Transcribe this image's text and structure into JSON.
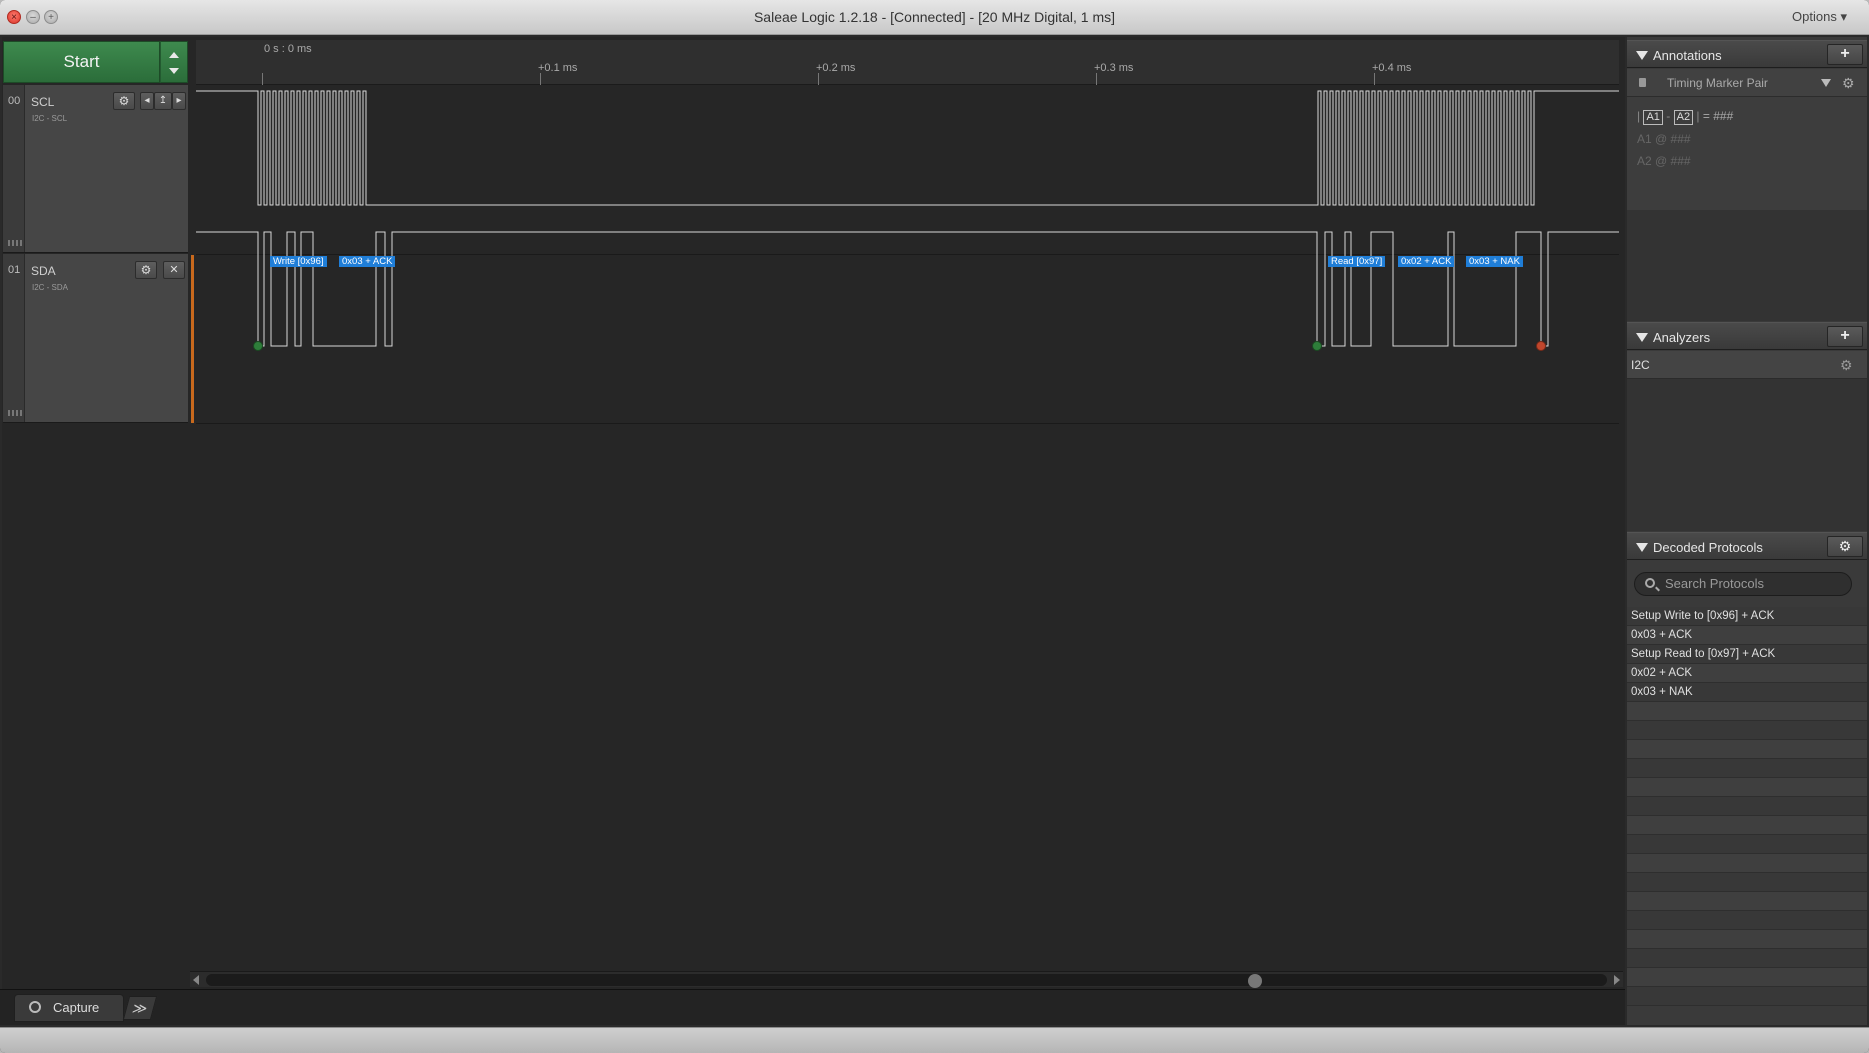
{
  "window": {
    "title": "Saleae Logic 1.2.18 - [Connected] - [20 MHz Digital, 1 ms]",
    "options_label": "Options ▾",
    "close_glyph": "×",
    "min_glyph": "–",
    "max_glyph": "+"
  },
  "capture": {
    "start_label": "Start"
  },
  "channels": [
    {
      "num": "00",
      "name": "SCL",
      "sub": "I2C - SCL"
    },
    {
      "num": "01",
      "name": "SDA",
      "sub": "I2C - SDA"
    }
  ],
  "channel_buttons": {
    "gear": "⚙",
    "prev": "◂",
    "trigger": "↥",
    "next": "▸",
    "close": "✕"
  },
  "timeline": {
    "reference": "0 s : 0 ms",
    "ticks": [
      "+0.1 ms",
      "+0.2 ms",
      "+0.3 ms",
      "+0.4 ms"
    ]
  },
  "decode_labels": [
    "Write [0x96]",
    "0x03 + ACK",
    "Read [0x97]",
    "0x02 + ACK",
    "0x03 + NAK"
  ],
  "annotations": {
    "title": "Annotations",
    "add": "+",
    "marker_pair": "Timing Marker Pair",
    "gear": "⚙",
    "line1": {
      "a": "A1",
      "sep": "-",
      "b": "A2",
      "eq": "= ###"
    },
    "line2": "A1  @  ###",
    "line3": "A2  @  ###"
  },
  "analyzers": {
    "title": "Analyzers",
    "add": "+",
    "items": [
      {
        "label": "I2C",
        "gear": "⚙"
      }
    ]
  },
  "decoded_protocols": {
    "title": "Decoded Protocols",
    "gear": "⚙",
    "search_placeholder": "Search Protocols",
    "rows": [
      "Setup Write to [0x96] + ACK",
      "0x03 + ACK",
      "Setup Read to [0x97] + ACK",
      "0x02 + ACK",
      "0x03 + NAK"
    ]
  },
  "tabs": {
    "capture": "Capture",
    "more": "≫"
  }
}
